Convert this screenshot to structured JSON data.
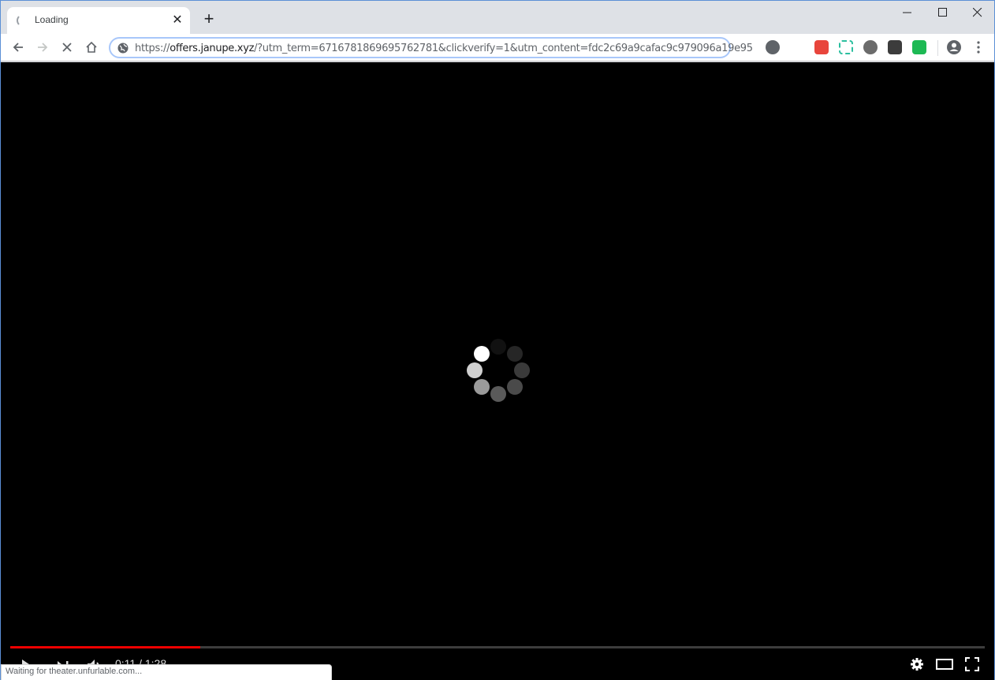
{
  "browser": {
    "tab": {
      "title": "Loading",
      "state": "loading"
    },
    "new_tab_label": "+",
    "window_controls": [
      "minimize",
      "maximize",
      "close"
    ],
    "url": {
      "scheme": "https://",
      "host": "offers.janupe.xyz",
      "path": "/?utm_term=6716781869695762781&clickverify=1&utm_content=fdc2c69a9cafac9c979096a19e95"
    },
    "extensions": [
      {
        "name": "music-extension-icon",
        "color": "#5f6368"
      },
      {
        "name": "mail-extension-icon",
        "color": "#e8453c"
      },
      {
        "name": "pdf-extension-icon",
        "color": "#2bbf9f"
      },
      {
        "name": "swirl-extension-icon",
        "color": "#6b6b6b"
      },
      {
        "name": "dark-cube-extension-icon",
        "color": "#3c3c3c"
      },
      {
        "name": "shield-extension-icon",
        "color": "#1db954"
      }
    ],
    "status_text": "Waiting for theater.unfurlable.com..."
  },
  "player": {
    "state": "buffering",
    "progress_fraction": 0.195,
    "time_current": "0:11",
    "time_total": "1:28",
    "time_display": "0:11 / 1:28",
    "colors": {
      "progress": "#ee0000",
      "track": "#3d3d3d"
    }
  }
}
